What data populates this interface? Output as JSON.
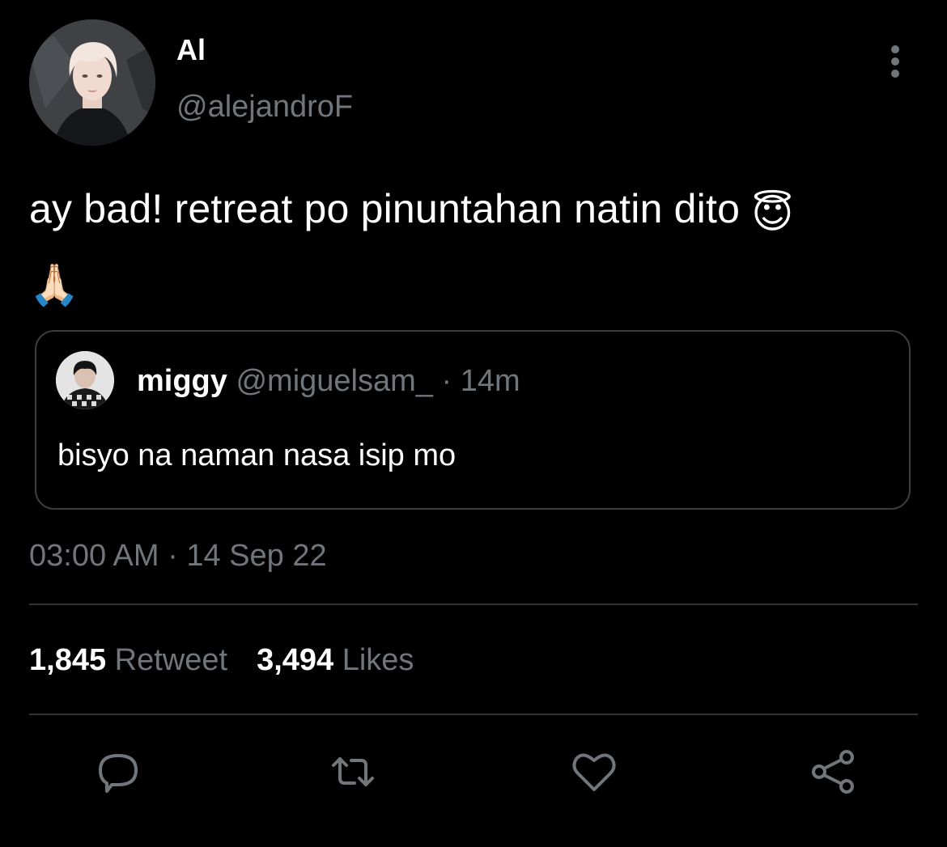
{
  "author": {
    "display_name": "Al",
    "handle": "@alejandroF"
  },
  "tweet": {
    "text": "ay bad! retreat po pinuntahan natin dito",
    "emoji_1": "😇",
    "emoji_2": "🙏🏻"
  },
  "quoted_tweet": {
    "display_name": "miggy",
    "handle": "@miguelsam_",
    "separator": "·",
    "time_ago": "14m",
    "text": "bisyo na naman nasa isip mo"
  },
  "timestamp": "03:00 AM · 14 Sep 22",
  "stats": {
    "retweets_count": "1,845",
    "retweets_label": "Retweet",
    "likes_count": "3,494",
    "likes_label": "Likes"
  },
  "actions": {
    "icons": [
      "reply-icon",
      "retweet-icon",
      "like-icon",
      "share-icon"
    ]
  },
  "colors": {
    "background": "#000000",
    "primary_text": "#ffffff",
    "secondary_text": "#71767b",
    "border": "#2f3336"
  }
}
